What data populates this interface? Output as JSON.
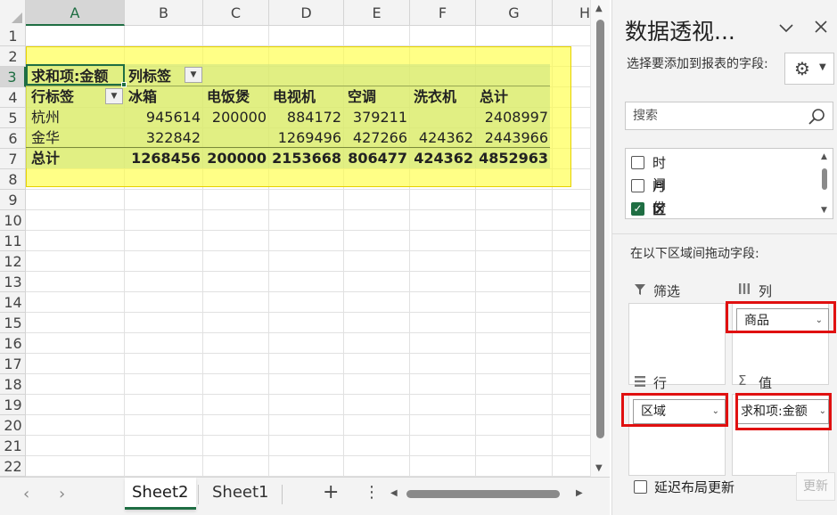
{
  "sheet": {
    "columns": [
      "A",
      "B",
      "C",
      "D",
      "E",
      "F",
      "G",
      "H"
    ],
    "rows": [
      "1",
      "2",
      "3",
      "4",
      "5",
      "6",
      "7",
      "8",
      "9",
      "10",
      "11",
      "12",
      "13",
      "14",
      "15",
      "16",
      "17",
      "18",
      "19",
      "20",
      "21",
      "22"
    ]
  },
  "pivot": {
    "value_label": "求和项:金额",
    "col_label": "列标签",
    "row_label": "行标签",
    "headers": [
      "冰箱",
      "电饭煲",
      "电视机",
      "空调",
      "洗衣机",
      "总计"
    ],
    "rows": [
      {
        "label": "杭州",
        "values": [
          "945614",
          "200000",
          "884172",
          "379211",
          "",
          "2408997"
        ]
      },
      {
        "label": "金华",
        "values": [
          "322842",
          "",
          "1269496",
          "427266",
          "424362",
          "2443966"
        ]
      }
    ],
    "total": {
      "label": "总计",
      "values": [
        "1268456",
        "200000",
        "2153668",
        "806477",
        "424362",
        "4852963"
      ]
    }
  },
  "tabs": {
    "sheets": [
      "Sheet2",
      "Sheet1"
    ],
    "active": "Sheet2",
    "add": "+",
    "more": "⋮"
  },
  "pane": {
    "title": "数据透视...",
    "subtitle": "选择要添加到报表的字段:",
    "search_placeholder": "搜索",
    "fields": [
      {
        "label": "时间",
        "checked": false
      },
      {
        "label": "月份",
        "checked": false
      },
      {
        "label": "区域",
        "checked": true
      }
    ],
    "drag_hint": "在以下区域间拖动字段:",
    "areas": {
      "filter": {
        "label": "筛选",
        "items": []
      },
      "columns": {
        "label": "列",
        "items": [
          "商品"
        ]
      },
      "rows": {
        "label": "行",
        "items": [
          "区域"
        ]
      },
      "values": {
        "label": "值",
        "items": [
          "求和项:金额"
        ]
      }
    },
    "defer_label": "延迟布局更新",
    "update_label": "更新"
  },
  "colors": {
    "accent": "#1f6e43",
    "highlight": "#ffff3c",
    "annotation": "#e01010"
  }
}
